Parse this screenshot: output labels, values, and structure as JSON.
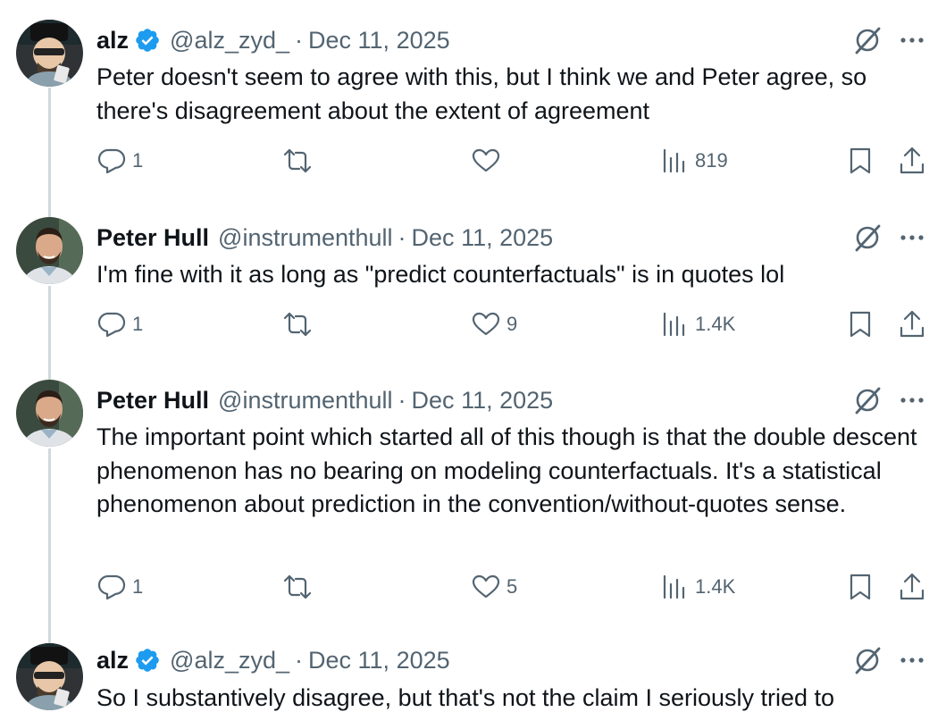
{
  "tweets": [
    {
      "name": "alz",
      "verified": true,
      "handle": "@alz_zyd_",
      "separator": "·",
      "date": "Dec 11, 2025",
      "text": "Peter doesn't seem to agree with this, but I think we and Peter agree, so there's disagreement about the extent of agreement",
      "replies": "1",
      "retweets": "",
      "likes": "",
      "views": "819"
    },
    {
      "name": "Peter Hull",
      "verified": false,
      "handle": "@instrumenthull",
      "separator": "·",
      "date": "Dec 11, 2025",
      "text": "I'm fine with it as long as \"predict counterfactuals\" is in quotes lol",
      "replies": "1",
      "retweets": "",
      "likes": "9",
      "views": "1.4K"
    },
    {
      "name": "Peter Hull",
      "verified": false,
      "handle": "@instrumenthull",
      "separator": "·",
      "date": "Dec 11, 2025",
      "text": "The important point which started all of this though is that the double descent phenomenon has no bearing on modeling counterfactuals. It's a statistical phenomenon about prediction in the convention/without-quotes sense.",
      "replies": "1",
      "retweets": "",
      "likes": "5",
      "views": "1.4K"
    },
    {
      "name": "alz",
      "verified": true,
      "handle": "@alz_zyd_",
      "separator": "·",
      "date": "Dec 11, 2025",
      "text": "So I substantively disagree, but that's not the claim I seriously tried to"
    }
  ],
  "colors": {
    "text": "#0f1419",
    "secondary": "#536471",
    "verified": "#1d9bf0",
    "thread_line": "#cfd9de"
  },
  "icons": {
    "reply": "reply-icon",
    "retweet": "retweet-icon",
    "like": "heart-icon",
    "views": "views-icon",
    "bookmark": "bookmark-icon",
    "share": "share-icon",
    "grok": "grok-icon",
    "more": "more-icon",
    "verified": "verified-badge-icon"
  }
}
